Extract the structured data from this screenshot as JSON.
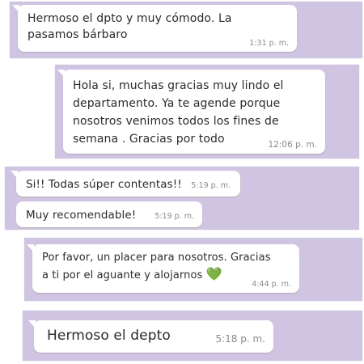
{
  "colors": {
    "strip_background": "#cfc4e2",
    "bubble_background": "#ffffff",
    "timestamp": "#8a8a8a",
    "heart": "#2fbf3a"
  },
  "messages": [
    {
      "text": "Hermoso el dpto y muy cómodo.  La\npasamos bárbaro",
      "time": "1:31 p. m."
    },
    {
      "text": "Hola si, muchas gracias muy lindo el\ndepartamento. Ya te agende  porque\nnosotros venimos todos los fines de\nsemana . Gracias por todo",
      "time": "12:06 p. m."
    },
    {
      "text": "Si!! Todas súper contentas!!",
      "time": "5:19 p. m."
    },
    {
      "text": "Muy recomendable!",
      "time": "5:19 p. m."
    },
    {
      "text": "Por favor, un placer para nosotros. Gracias\na ti por el aguante y alojarnos",
      "emoji": "💚",
      "time": "4:44 p. m."
    },
    {
      "text": "Hermoso el depto",
      "time": "5:18 p. m."
    }
  ]
}
